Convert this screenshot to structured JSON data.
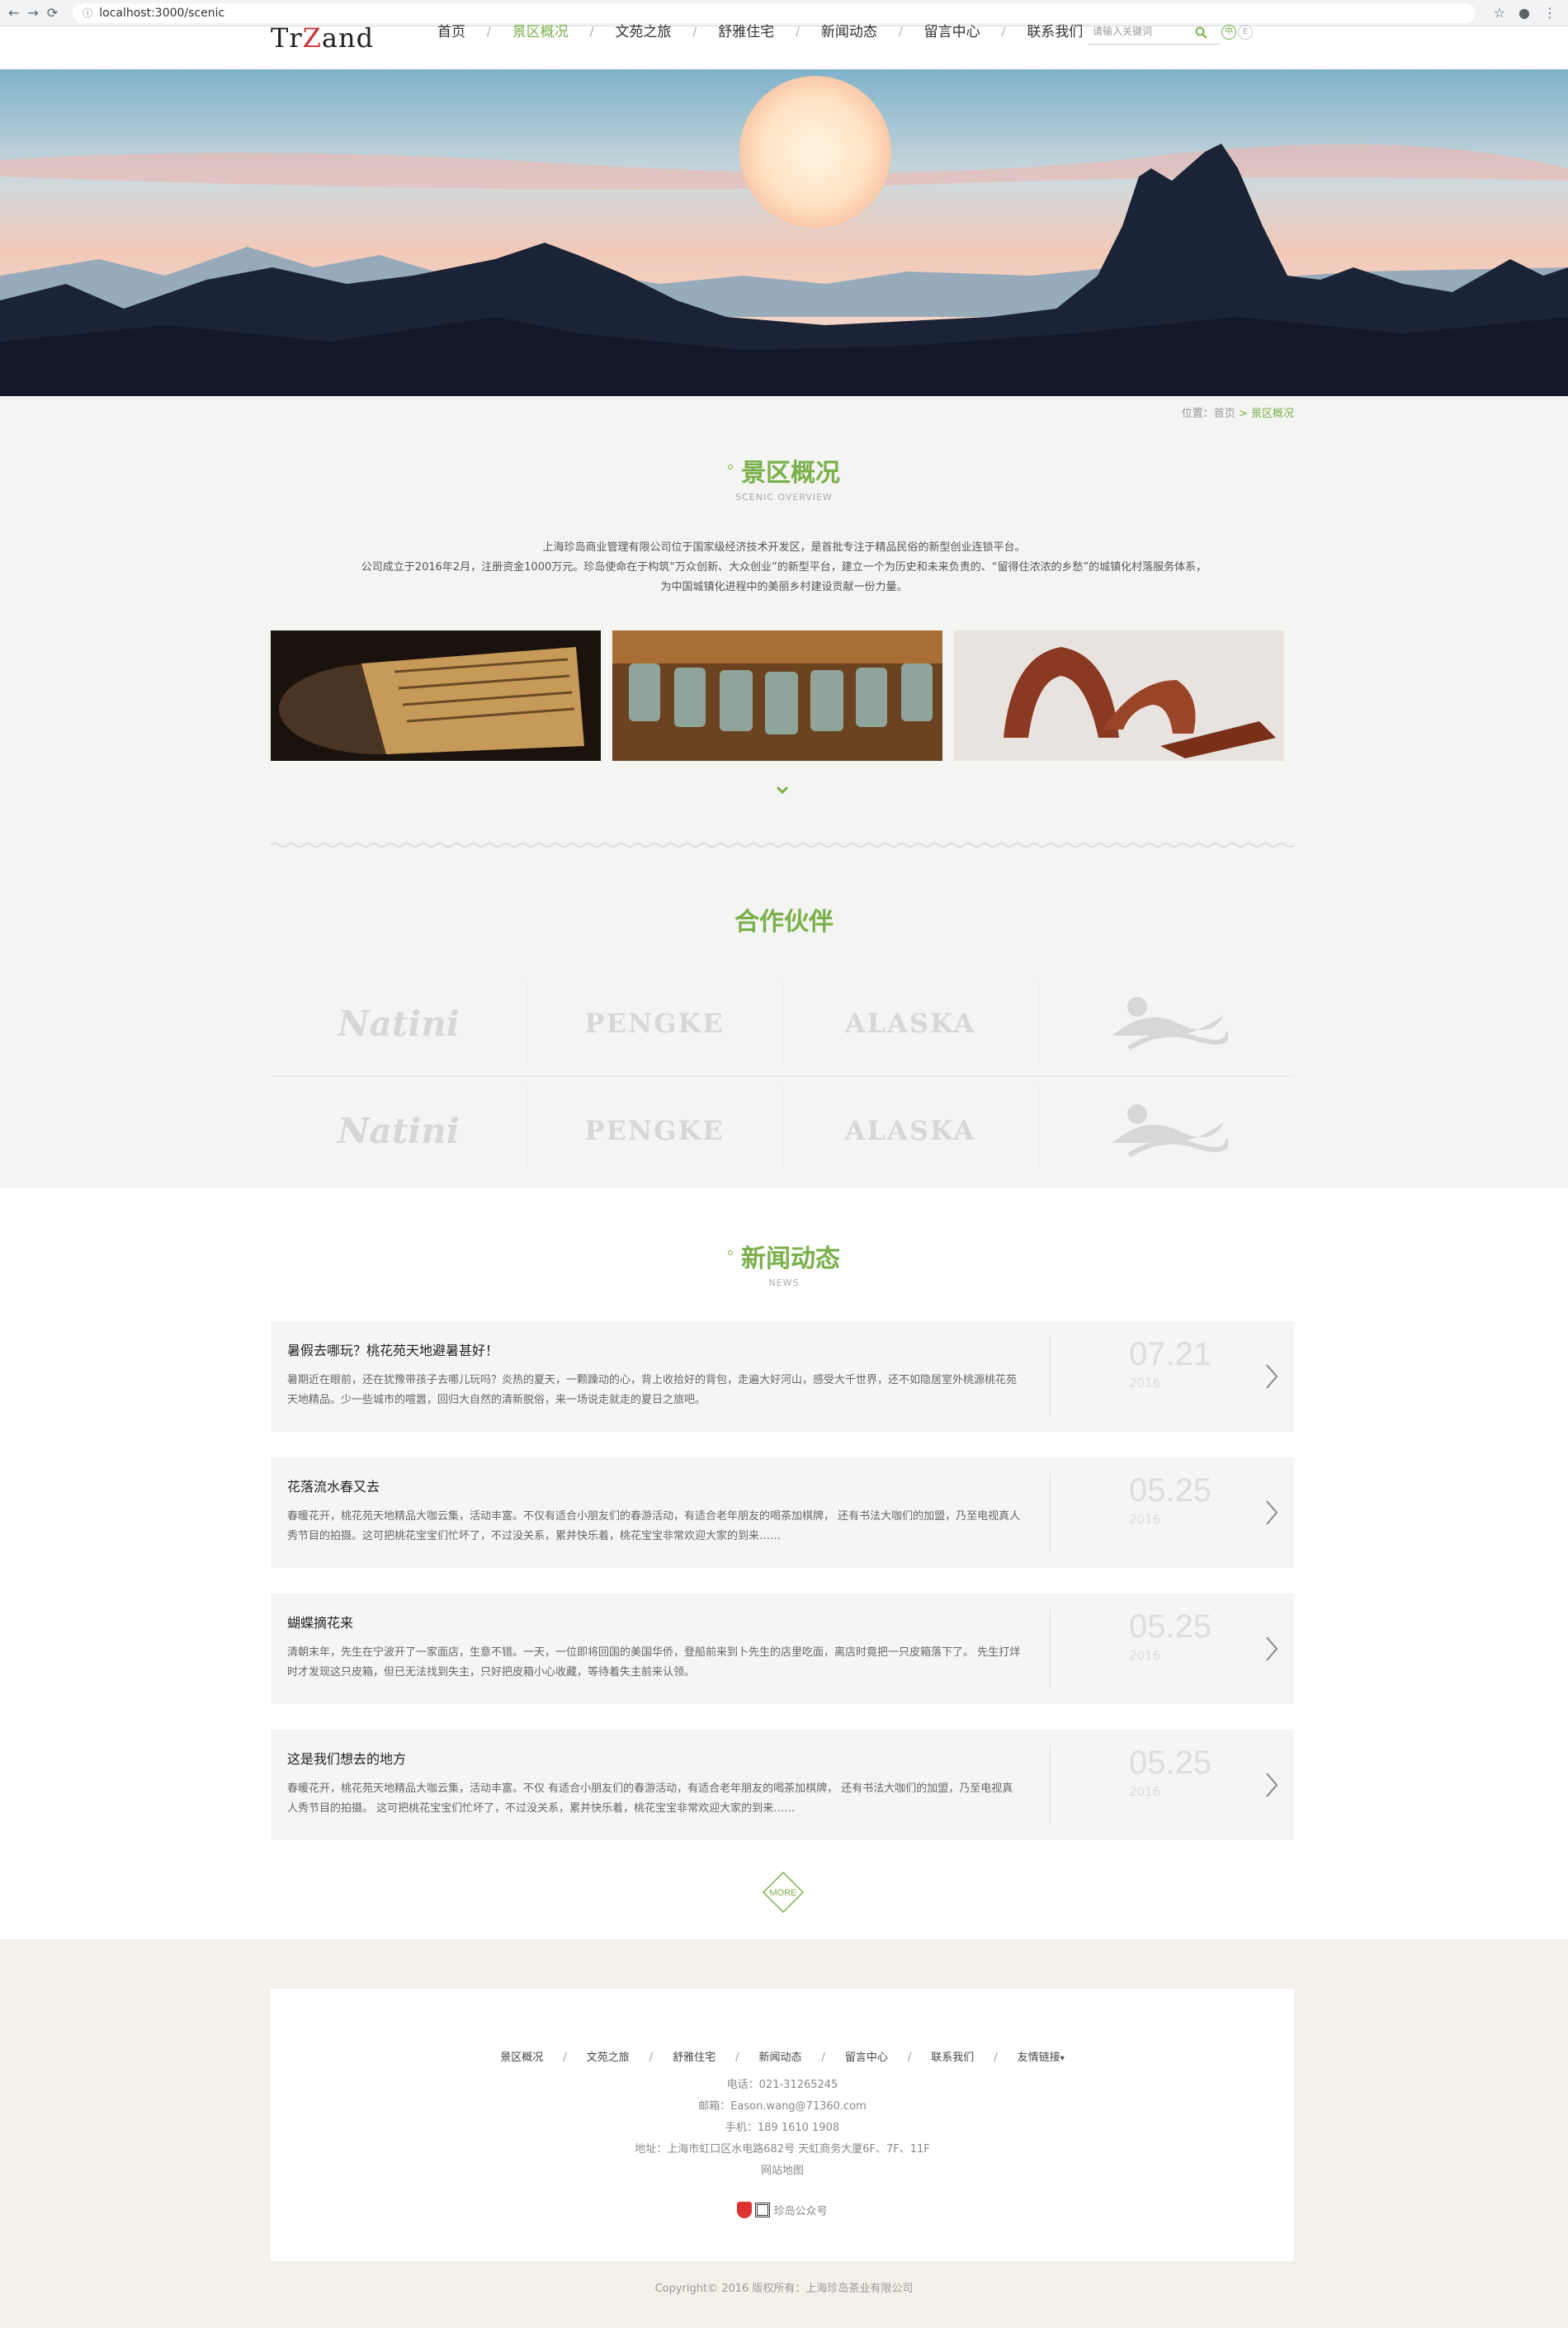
{
  "browser": {
    "url": "localhost:3000/scenic",
    "back_icon": "←",
    "forward_icon": "→",
    "reload_icon": "⟳"
  },
  "header": {
    "logo_text_1": "Tr",
    "logo_text_2": "and",
    "menu": [
      {
        "label": "首页",
        "active": false
      },
      {
        "label": "景区概况",
        "active": true
      },
      {
        "label": "文苑之旅",
        "active": false
      },
      {
        "label": "舒雅住宅",
        "active": false
      },
      {
        "label": "新闻动态",
        "active": false
      },
      {
        "label": "留言中心",
        "active": false
      },
      {
        "label": "联系我们",
        "active": false
      }
    ],
    "search_placeholder": "请输入关键词",
    "lang_cn": "中",
    "lang_en": "E"
  },
  "overview": {
    "breadcrumb_prefix": "位置：",
    "breadcrumb_home": "首页",
    "breadcrumb_sep": " > ",
    "breadcrumb_current": "景区概况",
    "title": "景区概况",
    "subtitle": "SCENIC OVERVIEW",
    "intro_1": "上海珍岛商业管理有限公司位于国家级经济技术开发区，是首批专注于精品民俗的新型创业连锁平台。",
    "intro_2": "公司成立于2016年2月，注册资金1000万元。珍岛使命在于构筑“万众创新、大众创业”的新型平台，建立一个为历史和未来负责的、“留得住浓浓的乡愁”的城镇化村落服务体系，",
    "intro_3": "为中国城镇化进程中的美丽乡村建设贡献一份力量。"
  },
  "partners": {
    "title": "合作伙伴",
    "logos": [
      "Natini",
      "PENGKE",
      "ALASKA",
      "wave",
      "Natini",
      "PENGKE",
      "ALASKA",
      "wave"
    ]
  },
  "news": {
    "title": "新闻动态",
    "subtitle": "NEWS",
    "items": [
      {
        "title": "暑假去哪玩？桃花苑天地避暑甚好！",
        "desc": "暑期近在眼前，还在犹豫带孩子去哪儿玩吗？炎热的夏天，一颗躁动的心，背上收拾好的背包，走遍大好河山，感受大千世界，还不如隐居室外桃源桃花苑天地精品。少一些城市的喧嚣，回归大自然的清新脱俗，来一场说走就走的夏日之旅吧。",
        "day": "07.21",
        "year": "2016"
      },
      {
        "title": "花落流水春又去",
        "desc": "春暖花开，桃花苑天地精品大咖云集，活动丰富。不仅有适合小朋友们的春游活动，有适合老年朋友的喝茶加棋牌， 还有书法大咖们的加盟，乃至电视真人秀节目的拍摄。这可把桃花宝宝们忙坏了，不过没关系，累并快乐着，桃花宝宝非常欢迎大家的到来……",
        "day": "05.25",
        "year": "2016"
      },
      {
        "title": "蝴蝶摘花来",
        "desc": "清朝末年，先生在宁波开了一家面店，生意不错。一天，一位即将回国的美国华侨，登船前来到卜先生的店里吃面，离店时竟把一只皮箱落下了。 先生打烊时才发现这只皮箱，但已无法找到失主，只好把皮箱小心收藏，等待着失主前来认领。",
        "day": "05.25",
        "year": "2016"
      },
      {
        "title": "这是我们想去的地方",
        "desc": "春暖花开，桃花苑天地精品大咖云集，活动丰富。不仅 有适合小朋友们的春游活动，有适合老年朋友的喝茶加棋牌， 还有书法大咖们的加盟，乃至电视真人秀节目的拍摄。 这可把桃花宝宝们忙坏了，不过没关系，累并快乐着，桃花宝宝非常欢迎大家的到来……",
        "day": "05.25",
        "year": "2016"
      }
    ],
    "more_label": "MORE"
  },
  "footer": {
    "nav": [
      "景区概况",
      "文苑之旅",
      "舒雅住宅",
      "新闻动态",
      "留言中心",
      "联系我们",
      "友情链接"
    ],
    "friend_arrow": "▾",
    "phone": "电话：021-31265245",
    "email": "邮箱：Eason.wang@71360.com",
    "mobile": "手机：189 1610 1908",
    "address": "地址：上海市虹口区水电路682号 天虹商务大厦6F、7F、11F",
    "sitemap": "网站地图",
    "wechat": "珍岛公众号",
    "copyright": "Copyright© 2016 版权所有：上海珍岛茶业有限公司"
  },
  "colors": {
    "accent": "#7ab04b",
    "news_bg": "#f5f5f5",
    "footer_bg": "#f4f0ea"
  }
}
